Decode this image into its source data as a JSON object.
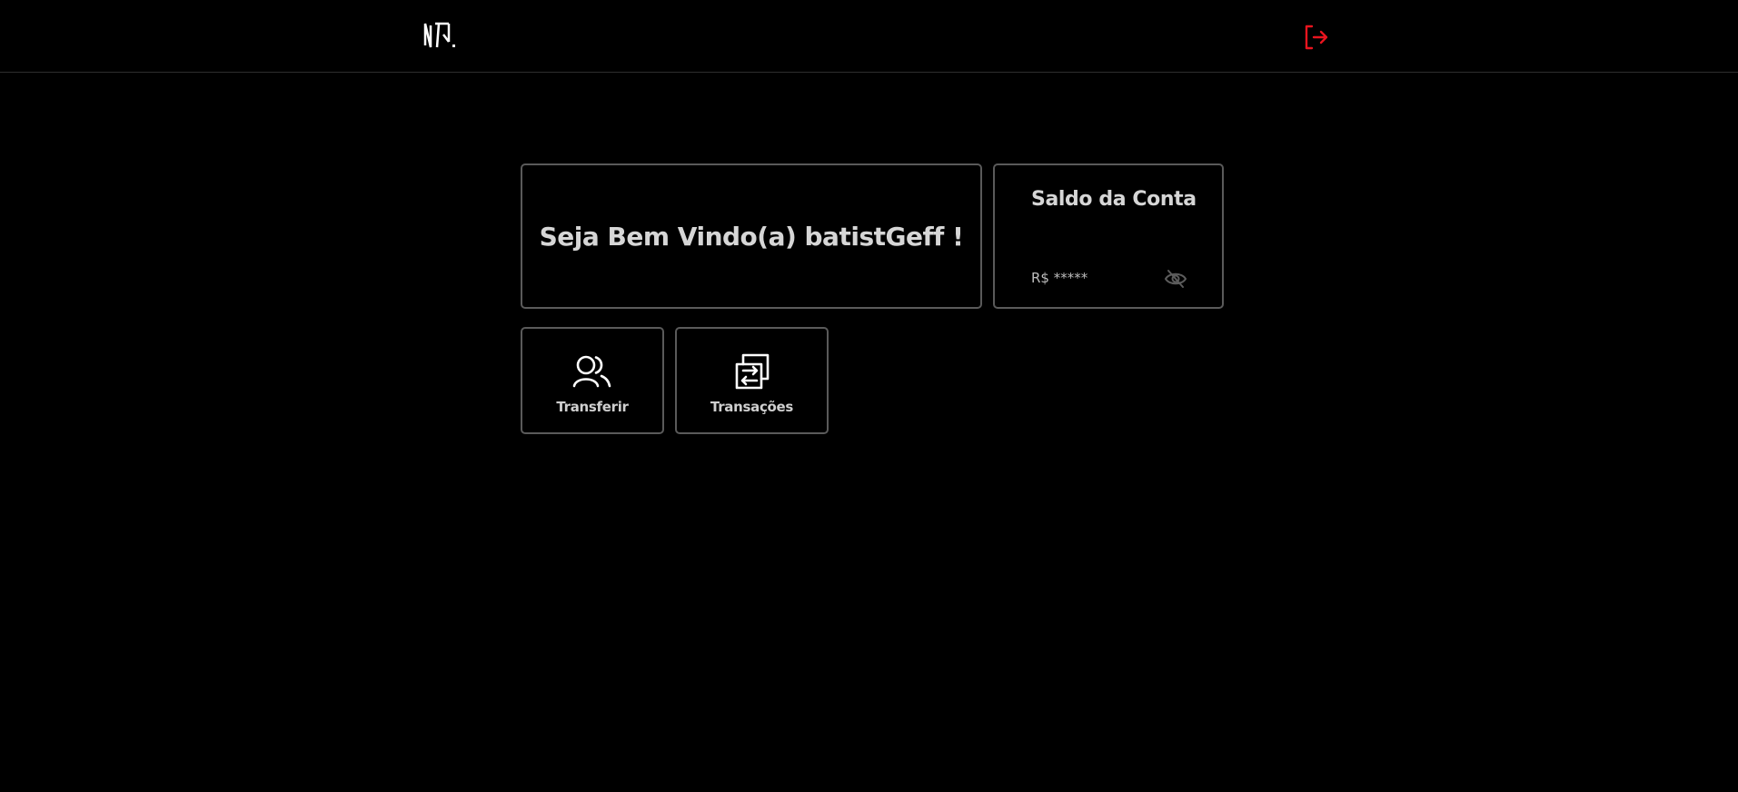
{
  "header": {
    "logo": "NG.",
    "logout_icon": "logout-icon",
    "accent_color": "#e8141e"
  },
  "welcome": {
    "text": "Seja Bem Vindo(a) batistGeff !"
  },
  "balance": {
    "title": "Saldo da Conta",
    "value": "R$ *****",
    "toggle_icon": "eye-off-icon"
  },
  "actions": [
    {
      "label": "Transferir",
      "icon": "users-icon"
    },
    {
      "label": "Transações",
      "icon": "arrows-exchange-icon"
    }
  ]
}
